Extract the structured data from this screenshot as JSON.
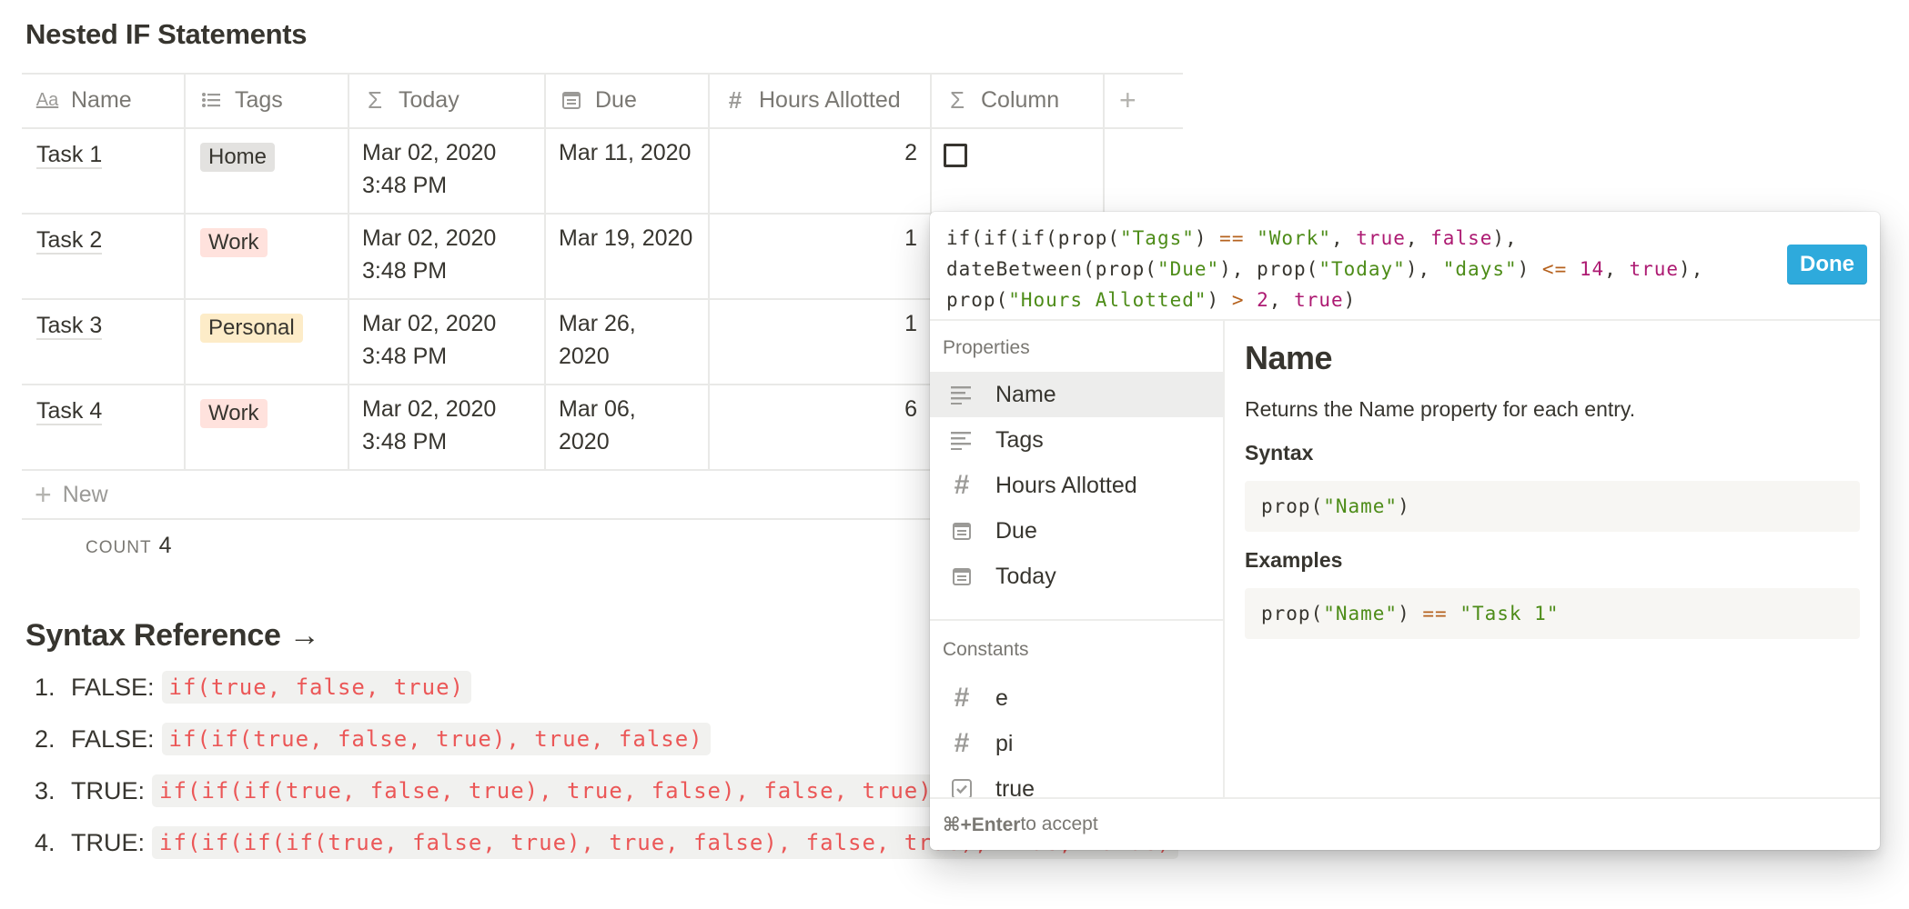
{
  "page_title": "Nested IF Statements",
  "table": {
    "columns": [
      {
        "label": "Name",
        "icon": "text-aa-icon"
      },
      {
        "label": "Tags",
        "icon": "list-icon"
      },
      {
        "label": "Today",
        "icon": "sigma-icon"
      },
      {
        "label": "Due",
        "icon": "calendar-icon"
      },
      {
        "label": "Hours Allotted",
        "icon": "hash-icon"
      },
      {
        "label": "Column",
        "icon": "sigma-icon"
      }
    ],
    "add_column_icon": "plus-icon",
    "rows": [
      {
        "name": "Task 1",
        "tag": "Home",
        "today": [
          "Mar 02, 2020",
          "3:48 PM"
        ],
        "due": [
          "Mar 11, 2020"
        ],
        "hours": "2"
      },
      {
        "name": "Task 2",
        "tag": "Work",
        "today": [
          "Mar 02, 2020",
          "3:48 PM"
        ],
        "due": [
          "Mar 19, 2020"
        ],
        "hours": "1"
      },
      {
        "name": "Task 3",
        "tag": "Personal",
        "today": [
          "Mar 02, 2020",
          "3:48 PM"
        ],
        "due": [
          "Mar 26,",
          "2020"
        ],
        "hours": "1"
      },
      {
        "name": "Task 4",
        "tag": "Work",
        "today": [
          "Mar 02, 2020",
          "3:48 PM"
        ],
        "due": [
          "Mar 06,",
          "2020"
        ],
        "hours": "6"
      }
    ],
    "tag_colors": {
      "Home": "#e3e2e0",
      "Work": "#ffe2dd",
      "Personal": "#fdecc8"
    },
    "new_label": "New",
    "count_label": "COUNT",
    "count_value": "4"
  },
  "syntax": {
    "heading": "Syntax Reference →",
    "items": [
      {
        "num": "1.",
        "label": "FALSE:",
        "code": "if(true, false, true)"
      },
      {
        "num": "2.",
        "label": "FALSE:",
        "code": "if(if(true, false, true), true, false)"
      },
      {
        "num": "3.",
        "label": "TRUE:",
        "code": "if(if(if(true, false, true), true, false), false, true)"
      },
      {
        "num": "4.",
        "label": "TRUE:",
        "code": "if(if(if(if(true, false, true), true, false), false, true), true, false)"
      }
    ]
  },
  "popup": {
    "formula_lines": [
      "if(if(if(prop(\"Tags\") == \"Work\", true, false),",
      "dateBetween(prop(\"Due\"), prop(\"Today\"), \"days\") <= 14, true),",
      "prop(\"Hours Allotted\") > 2, true)"
    ],
    "done_label": "Done",
    "properties_label": "Properties",
    "properties": [
      {
        "label": "Name",
        "icon": "text-lines-icon"
      },
      {
        "label": "Tags",
        "icon": "text-lines-icon"
      },
      {
        "label": "Hours Allotted",
        "icon": "hash-icon"
      },
      {
        "label": "Due",
        "icon": "calendar-icon"
      },
      {
        "label": "Today",
        "icon": "calendar-icon"
      }
    ],
    "constants_label": "Constants",
    "constants": [
      {
        "label": "e",
        "icon": "hash-icon"
      },
      {
        "label": "pi",
        "icon": "hash-icon"
      },
      {
        "label": "true",
        "icon": "checkbox-icon"
      }
    ],
    "detail": {
      "title": "Name",
      "description": "Returns the Name property for each entry.",
      "syntax_label": "Syntax",
      "syntax_code": "prop(\"Name\")",
      "examples_label": "Examples",
      "example_code": "prop(\"Name\") == \"Task 1\""
    },
    "footer_key": "⌘+Enter",
    "footer_text": " to accept"
  },
  "colors": {
    "accent": "#2eaadc",
    "code_red": "#eb5757",
    "string_green": "#4d8c18",
    "keyword_purple": "#ad1a72"
  }
}
